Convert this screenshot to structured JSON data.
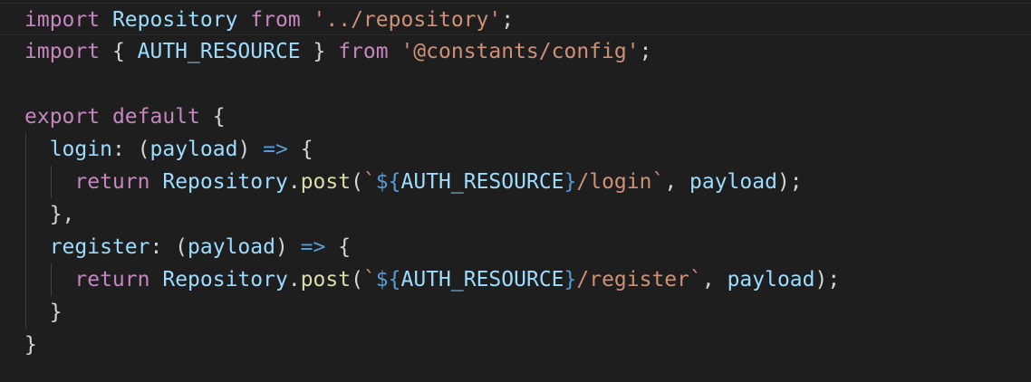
{
  "colors": {
    "background": "#1e1e1e",
    "keyword": "#c586c0",
    "variable": "#9cdcfe",
    "function": "#dcdcaa",
    "string": "#ce9178",
    "operator": "#569cd6",
    "plain": "#d4d4d4"
  },
  "lines": [
    [
      {
        "text": "import",
        "kind": "keyword"
      },
      {
        "text": " ",
        "kind": "plain"
      },
      {
        "text": "Repository",
        "kind": "variable"
      },
      {
        "text": " ",
        "kind": "plain"
      },
      {
        "text": "from",
        "kind": "keyword"
      },
      {
        "text": " ",
        "kind": "plain"
      },
      {
        "text": "'../repository'",
        "kind": "string"
      },
      {
        "text": ";",
        "kind": "plain"
      }
    ],
    [
      {
        "text": "import",
        "kind": "keyword"
      },
      {
        "text": " { ",
        "kind": "plain"
      },
      {
        "text": "AUTH_RESOURCE",
        "kind": "variable"
      },
      {
        "text": " } ",
        "kind": "plain"
      },
      {
        "text": "from",
        "kind": "keyword"
      },
      {
        "text": " ",
        "kind": "plain"
      },
      {
        "text": "'@constants/config'",
        "kind": "string"
      },
      {
        "text": ";",
        "kind": "plain"
      }
    ],
    [],
    [
      {
        "text": "export",
        "kind": "keyword"
      },
      {
        "text": " ",
        "kind": "plain"
      },
      {
        "text": "default",
        "kind": "keyword"
      },
      {
        "text": " {",
        "kind": "plain"
      }
    ],
    [
      {
        "text": "  ",
        "kind": "plain"
      },
      {
        "text": "login",
        "kind": "variable"
      },
      {
        "text": ": (",
        "kind": "plain"
      },
      {
        "text": "payload",
        "kind": "variable"
      },
      {
        "text": ") ",
        "kind": "plain"
      },
      {
        "text": "=>",
        "kind": "operator"
      },
      {
        "text": " {",
        "kind": "plain"
      }
    ],
    [
      {
        "text": "    ",
        "kind": "plain"
      },
      {
        "text": "return",
        "kind": "keyword"
      },
      {
        "text": " ",
        "kind": "plain"
      },
      {
        "text": "Repository",
        "kind": "variable"
      },
      {
        "text": ".",
        "kind": "plain"
      },
      {
        "text": "post",
        "kind": "function"
      },
      {
        "text": "(",
        "kind": "plain"
      },
      {
        "text": "`",
        "kind": "string"
      },
      {
        "text": "${",
        "kind": "operator"
      },
      {
        "text": "AUTH_RESOURCE",
        "kind": "variable"
      },
      {
        "text": "}",
        "kind": "operator"
      },
      {
        "text": "/login`",
        "kind": "string"
      },
      {
        "text": ", ",
        "kind": "plain"
      },
      {
        "text": "payload",
        "kind": "variable"
      },
      {
        "text": ");",
        "kind": "plain"
      }
    ],
    [
      {
        "text": "  },",
        "kind": "plain"
      }
    ],
    [
      {
        "text": "  ",
        "kind": "plain"
      },
      {
        "text": "register",
        "kind": "variable"
      },
      {
        "text": ": (",
        "kind": "plain"
      },
      {
        "text": "payload",
        "kind": "variable"
      },
      {
        "text": ") ",
        "kind": "plain"
      },
      {
        "text": "=>",
        "kind": "operator"
      },
      {
        "text": " {",
        "kind": "plain"
      }
    ],
    [
      {
        "text": "    ",
        "kind": "plain"
      },
      {
        "text": "return",
        "kind": "keyword"
      },
      {
        "text": " ",
        "kind": "plain"
      },
      {
        "text": "Repository",
        "kind": "variable"
      },
      {
        "text": ".",
        "kind": "plain"
      },
      {
        "text": "post",
        "kind": "function"
      },
      {
        "text": "(",
        "kind": "plain"
      },
      {
        "text": "`",
        "kind": "string"
      },
      {
        "text": "${",
        "kind": "operator"
      },
      {
        "text": "AUTH_RESOURCE",
        "kind": "variable"
      },
      {
        "text": "}",
        "kind": "operator"
      },
      {
        "text": "/register`",
        "kind": "string"
      },
      {
        "text": ", ",
        "kind": "plain"
      },
      {
        "text": "payload",
        "kind": "variable"
      },
      {
        "text": ");",
        "kind": "plain"
      }
    ],
    [
      {
        "text": "  }",
        "kind": "plain"
      }
    ],
    [
      {
        "text": "}",
        "kind": "plain"
      }
    ]
  ]
}
